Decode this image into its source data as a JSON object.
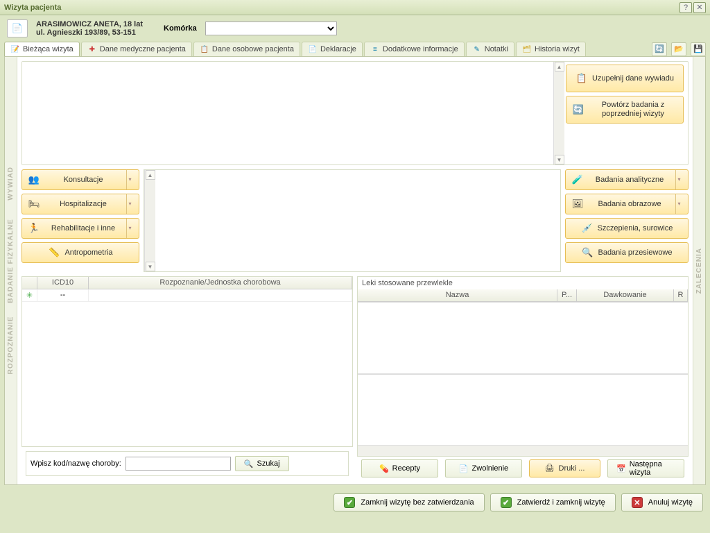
{
  "window": {
    "title": "Wizyta pacjenta"
  },
  "patient": {
    "name_age": "ARASIMOWICZ ANETA,  18 lat",
    "address": "ul. Agnieszki 193/89, 53-151",
    "cell_label": "Komórka"
  },
  "tabs": [
    {
      "label": "Bieżąca wizyta"
    },
    {
      "label": "Dane medyczne pacjenta"
    },
    {
      "label": "Dane osobowe pacjenta"
    },
    {
      "label": "Deklaracje"
    },
    {
      "label": "Dodatkowe informacje"
    },
    {
      "label": "Notatki"
    },
    {
      "label": "Historia wizyt"
    }
  ],
  "vtabs": {
    "wywiad": "WYWIAD",
    "badanie": "BADANIE FIZYKALNE",
    "rozpoznanie": "ROZPOZNANIE",
    "zalecenia": "ZALECENIA"
  },
  "wywiad_buttons": [
    {
      "label": "Uzupełnij dane wywiadu"
    },
    {
      "label": "Powtórz badania z poprzedniej wizyty"
    }
  ],
  "left_buttons": [
    {
      "label": "Konsultacje"
    },
    {
      "label": "Hospitalizacje"
    },
    {
      "label": "Rehabilitacje i inne"
    },
    {
      "label": "Antropometria"
    }
  ],
  "right_buttons": [
    {
      "label": "Badania analityczne"
    },
    {
      "label": "Badania obrazowe"
    },
    {
      "label": "Szczepienia, surowice"
    },
    {
      "label": "Badania przesiewowe"
    }
  ],
  "icd_grid": {
    "cols": {
      "c1": "",
      "c2": "ICD10",
      "c3": "Rozpoznanie/Jednostka chorobowa"
    },
    "row": {
      "c1": "✳",
      "c2": "--",
      "c3": ""
    }
  },
  "search": {
    "label": "Wpisz kod/nazwę choroby:",
    "btn": "Szukaj"
  },
  "meds": {
    "title": "Leki stosowane przewlekle",
    "cols": {
      "c1": "Nazwa",
      "c2": "P...",
      "c3": "Dawkowanie",
      "c4": "R"
    }
  },
  "bottom_buttons": [
    {
      "label": "Recepty"
    },
    {
      "label": "Zwolnienie"
    },
    {
      "label": "Druki ..."
    },
    {
      "label": "Następna wizyta"
    }
  ],
  "footer": {
    "close_no_approve": "Zamknij wizytę bez zatwierdzania",
    "approve_close": "Zatwierdź i zamknij wizytę",
    "cancel": "Anuluj wizytę"
  }
}
